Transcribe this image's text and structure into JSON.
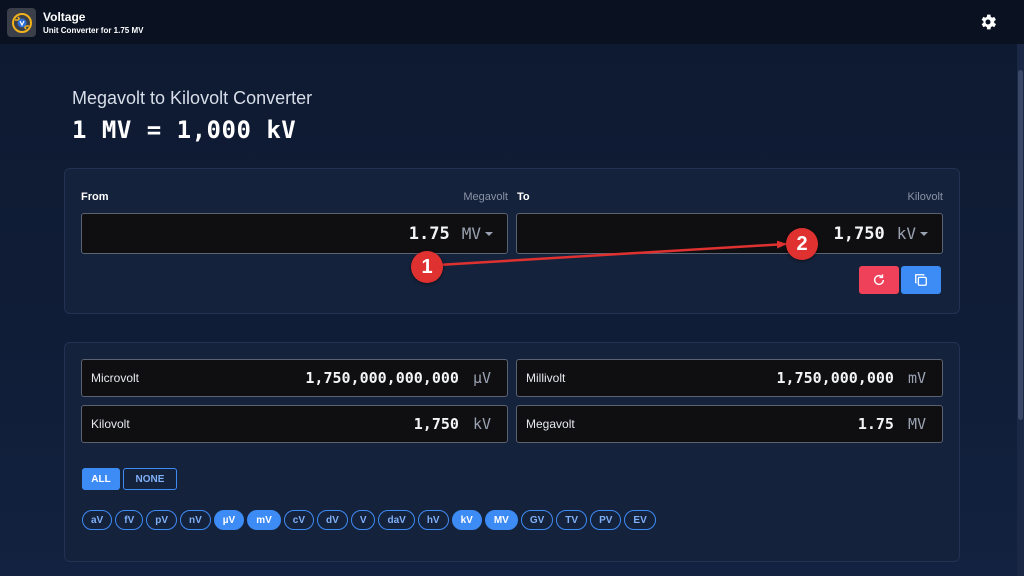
{
  "app": {
    "title": "Voltage",
    "subtitle": "Unit Converter for 1.75 MV",
    "logo_icon": "voltage-logo-icon",
    "settings_icon": "gear-icon"
  },
  "page": {
    "heading": "Megavolt to Kilovolt Converter",
    "formula": "1 MV = 1,000 kV"
  },
  "converter": {
    "from_label": "From",
    "from_unit_name": "Megavolt",
    "from_value": "1.75",
    "from_unit": "MV",
    "to_label": "To",
    "to_unit_name": "Kilovolt",
    "to_value": "1,750",
    "to_unit": "kV",
    "reset_icon": "refresh-icon",
    "copy_icon": "copy-icon",
    "colors": {
      "reset": "#ef4159",
      "copy": "#3d8bf5"
    }
  },
  "results": [
    {
      "name": "Microvolt",
      "value": "1,750,000,000,000",
      "unit": "µV"
    },
    {
      "name": "Millivolt",
      "value": "1,750,000,000",
      "unit": "mV"
    },
    {
      "name": "Kilovolt",
      "value": "1,750",
      "unit": "kV"
    },
    {
      "name": "Megavolt",
      "value": "1.75",
      "unit": "MV"
    }
  ],
  "selection": {
    "all_label": "ALL",
    "none_label": "NONE"
  },
  "chips": [
    {
      "label": "aV",
      "selected": false
    },
    {
      "label": "fV",
      "selected": false
    },
    {
      "label": "pV",
      "selected": false
    },
    {
      "label": "nV",
      "selected": false
    },
    {
      "label": "µV",
      "selected": true
    },
    {
      "label": "mV",
      "selected": true
    },
    {
      "label": "cV",
      "selected": false
    },
    {
      "label": "dV",
      "selected": false
    },
    {
      "label": "V",
      "selected": false
    },
    {
      "label": "daV",
      "selected": false
    },
    {
      "label": "hV",
      "selected": false
    },
    {
      "label": "kV",
      "selected": true
    },
    {
      "label": "MV",
      "selected": true
    },
    {
      "label": "GV",
      "selected": false
    },
    {
      "label": "TV",
      "selected": false
    },
    {
      "label": "PV",
      "selected": false
    },
    {
      "label": "EV",
      "selected": false
    }
  ],
  "annotations": {
    "badge_1": "1",
    "badge_2": "2",
    "arrow_color": "#e03131"
  }
}
